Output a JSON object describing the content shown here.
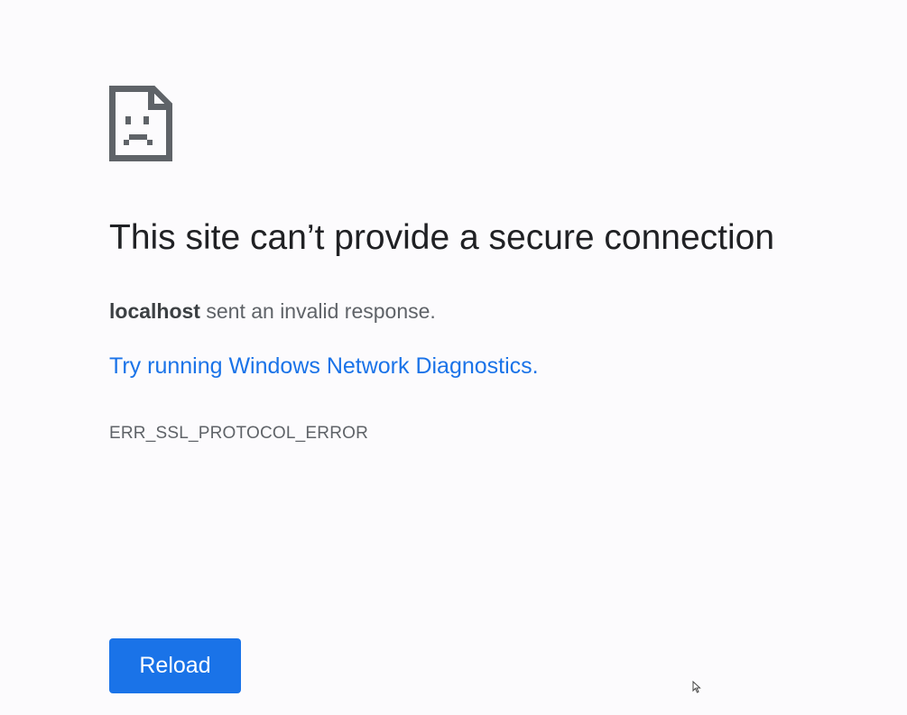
{
  "error_page": {
    "icon": "sad-page-icon",
    "heading": "This site can’t provide a secure connection",
    "summary_host": "localhost",
    "summary_text": " sent an invalid response.",
    "diagnostics_link": "Try running Windows Network Diagnostics.",
    "error_code": "ERR_SSL_PROTOCOL_ERROR",
    "reload_label": "Reload"
  },
  "colors": {
    "background": "#fcfbfd",
    "heading": "#202124",
    "secondary_text": "#5f6368",
    "link": "#1a73e8",
    "button": "#1a73e8",
    "button_text": "#ffffff"
  },
  "pointer": "mouse-pointer-icon"
}
